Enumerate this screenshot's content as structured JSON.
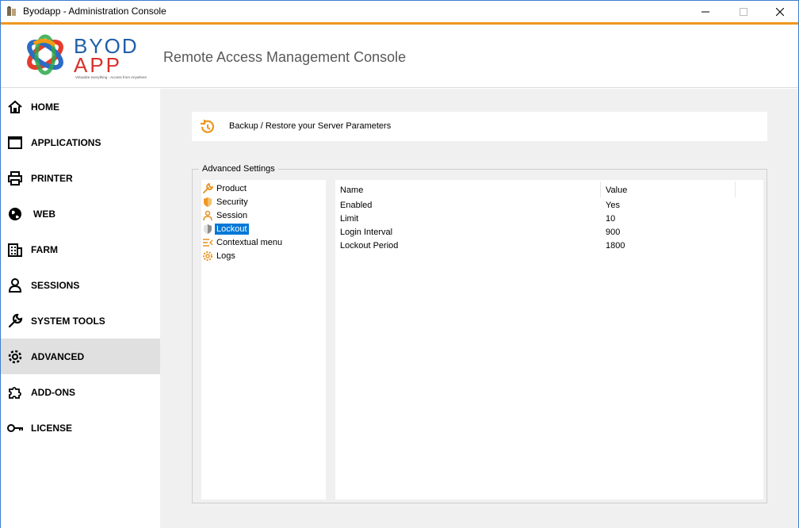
{
  "window": {
    "title": "Byodapp - Administration Console",
    "accent_color": "#f0961e"
  },
  "header": {
    "logo_text": "BYOD APP",
    "logo_tagline": "Virtualize everything - Access from Anywhere",
    "title": "Remote Access Management Console"
  },
  "sidebar": {
    "items": [
      {
        "label": "HOME",
        "icon": "home-icon"
      },
      {
        "label": "APPLICATIONS",
        "icon": "window-icon"
      },
      {
        "label": "PRINTER",
        "icon": "printer-icon"
      },
      {
        "label": "WEB",
        "icon": "globe-icon"
      },
      {
        "label": "FARM",
        "icon": "building-icon"
      },
      {
        "label": "SESSIONS",
        "icon": "user-icon"
      },
      {
        "label": "SYSTEM TOOLS",
        "icon": "wrench-icon"
      },
      {
        "label": "ADVANCED",
        "icon": "gear-icon"
      },
      {
        "label": "ADD-ONS",
        "icon": "puzzle-icon"
      },
      {
        "label": "LICENSE",
        "icon": "key-icon"
      }
    ],
    "active": "ADVANCED"
  },
  "main": {
    "backup_label": "Backup / Restore your Server Parameters",
    "group_title": "Advanced Settings",
    "tree": [
      {
        "label": "Product",
        "icon": "wrench-icon"
      },
      {
        "label": "Security",
        "icon": "shield-icon"
      },
      {
        "label": "Session",
        "icon": "user-icon"
      },
      {
        "label": "Lockout",
        "icon": "shield-lock-icon"
      },
      {
        "label": "Contextual menu",
        "icon": "menu-icon"
      },
      {
        "label": "Logs",
        "icon": "gear-icon"
      }
    ],
    "selected_tree_item": "Lockout",
    "table": {
      "columns": [
        "Name",
        "Value"
      ],
      "rows": [
        {
          "name": "Enabled",
          "value": "Yes"
        },
        {
          "name": "Limit",
          "value": "10"
        },
        {
          "name": "Login Interval",
          "value": "900"
        },
        {
          "name": "Lockout Period",
          "value": "1800"
        }
      ]
    }
  }
}
